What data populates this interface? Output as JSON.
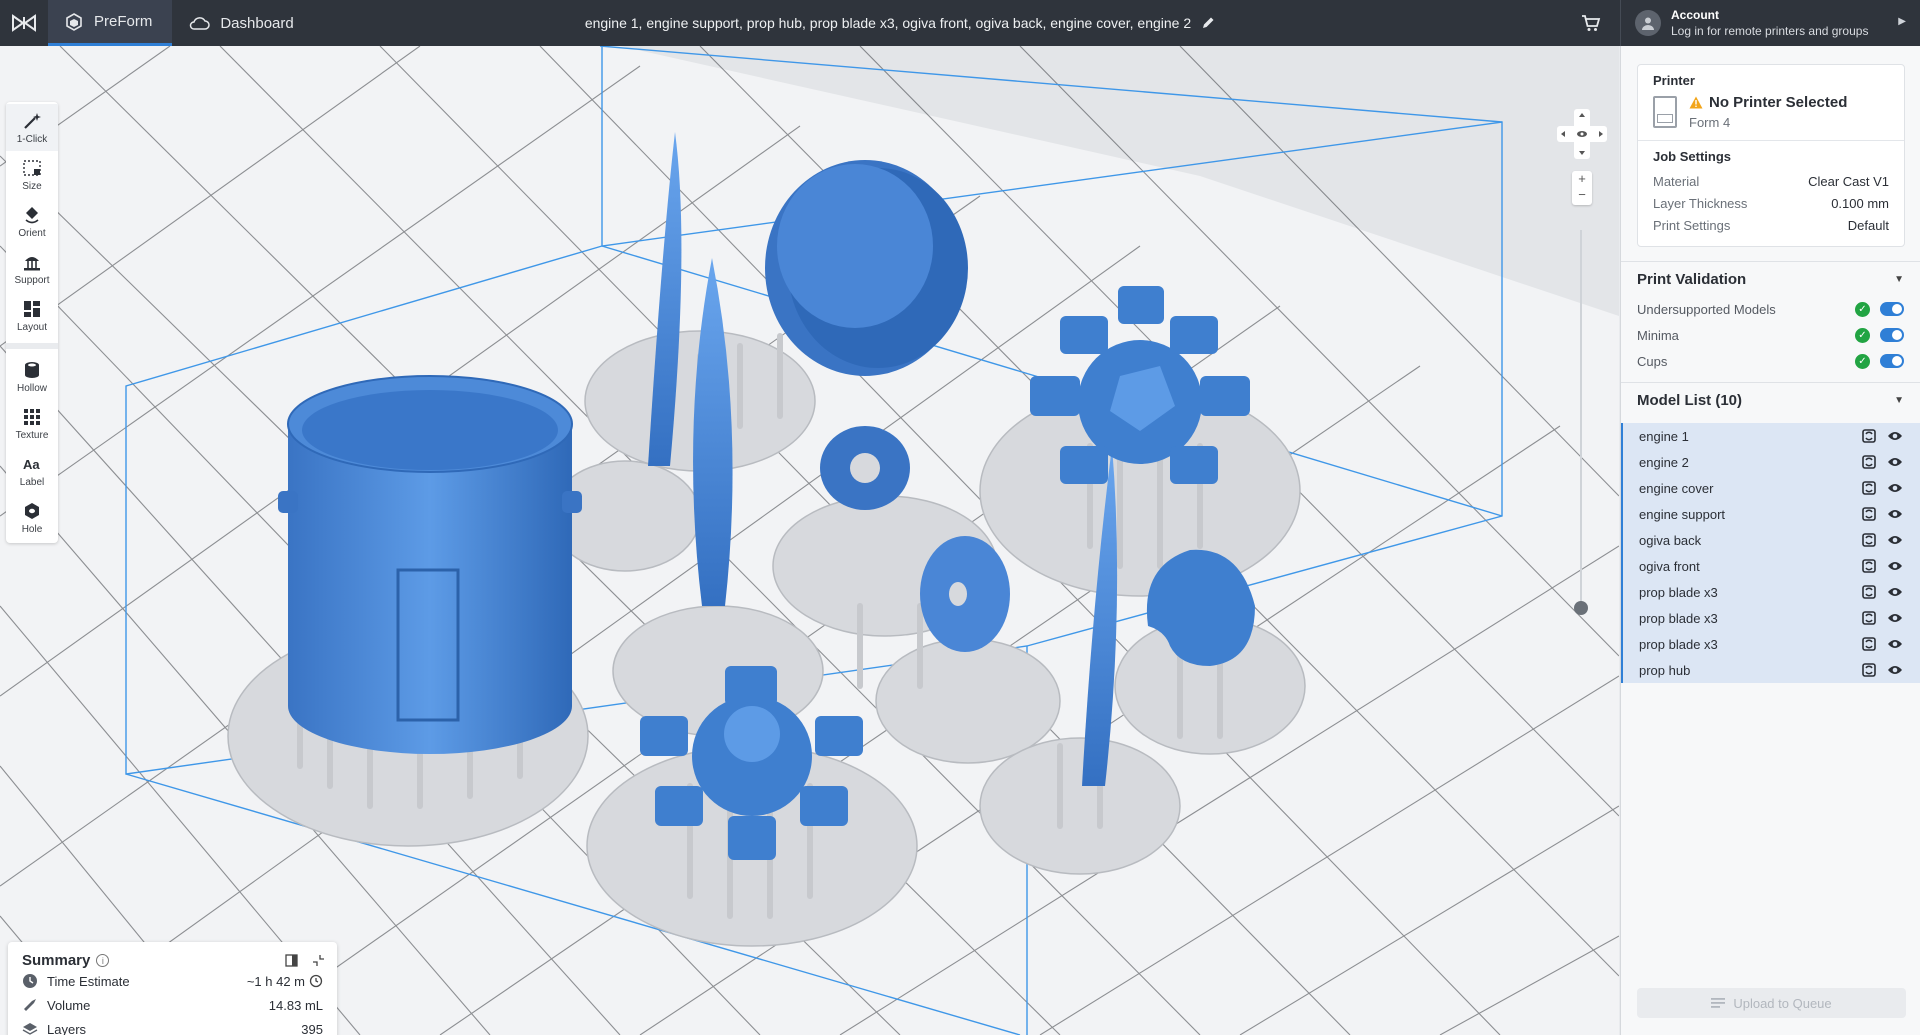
{
  "topbar": {
    "tabs": [
      {
        "label": "PreForm",
        "icon": "preform-icon",
        "active": true
      },
      {
        "label": "Dashboard",
        "icon": "cloud-icon",
        "active": false
      }
    ],
    "document_title": "engine 1, engine support, prop hub, prop blade x3, ogiva front, ogiva back, engine cover, engine 2",
    "account": {
      "title": "Account",
      "subtitle": "Log in for remote printers and groups"
    }
  },
  "toolbar": {
    "tools": [
      {
        "label": "1-Click",
        "icon": "magic-wand-icon"
      },
      {
        "label": "Size",
        "icon": "size-icon"
      },
      {
        "label": "Orient",
        "icon": "orient-icon"
      },
      {
        "label": "Support",
        "icon": "support-icon"
      },
      {
        "label": "Layout",
        "icon": "layout-icon"
      },
      {
        "label": "Hollow",
        "icon": "hollow-icon"
      },
      {
        "label": "Texture",
        "icon": "texture-icon"
      },
      {
        "label": "Label",
        "icon": "label-icon"
      },
      {
        "label": "Hole",
        "icon": "hole-icon"
      }
    ]
  },
  "viewport": {
    "zoom_in": "+",
    "zoom_out": "−",
    "plate_labels": [
      "engine cover",
      "prop blade x3",
      "engine support",
      "prop hub",
      "engine 2",
      "ogiva back",
      "ogiva front",
      "engine 1",
      "prop blade x3"
    ]
  },
  "summary": {
    "title": "Summary",
    "rows": [
      {
        "label": "Time Estimate",
        "value": "~1 h 42 m",
        "icon": "clock-icon"
      },
      {
        "label": "Volume",
        "value": "14.83 mL",
        "icon": "droplet-icon"
      },
      {
        "label": "Layers",
        "value": "395",
        "icon": "layers-icon"
      }
    ]
  },
  "printer": {
    "section_title": "Printer",
    "status": "No Printer Selected",
    "model": "Form 4"
  },
  "job_settings": {
    "title": "Job Settings",
    "rows": [
      {
        "key": "Material",
        "value": "Clear Cast V1"
      },
      {
        "key": "Layer Thickness",
        "value": "0.100 mm"
      },
      {
        "key": "Print Settings",
        "value": "Default"
      }
    ]
  },
  "print_validation": {
    "title": "Print Validation",
    "rows": [
      {
        "label": "Undersupported Models",
        "enabled": true
      },
      {
        "label": "Minima",
        "enabled": true
      },
      {
        "label": "Cups",
        "enabled": true
      }
    ]
  },
  "model_list": {
    "title": "Model List (10)",
    "items": [
      "engine 1",
      "engine 2",
      "engine cover",
      "engine support",
      "ogiva back",
      "ogiva front",
      "prop blade x3",
      "prop blade x3",
      "prop blade x3",
      "prop hub"
    ]
  },
  "upload_button": "Upload to Queue",
  "colors": {
    "accent": "#2f7fd6",
    "model_blue": "#3f7fcf",
    "support_gray": "#d9dbdf",
    "topbar": "#2f343c",
    "valid_green": "#22a443"
  }
}
